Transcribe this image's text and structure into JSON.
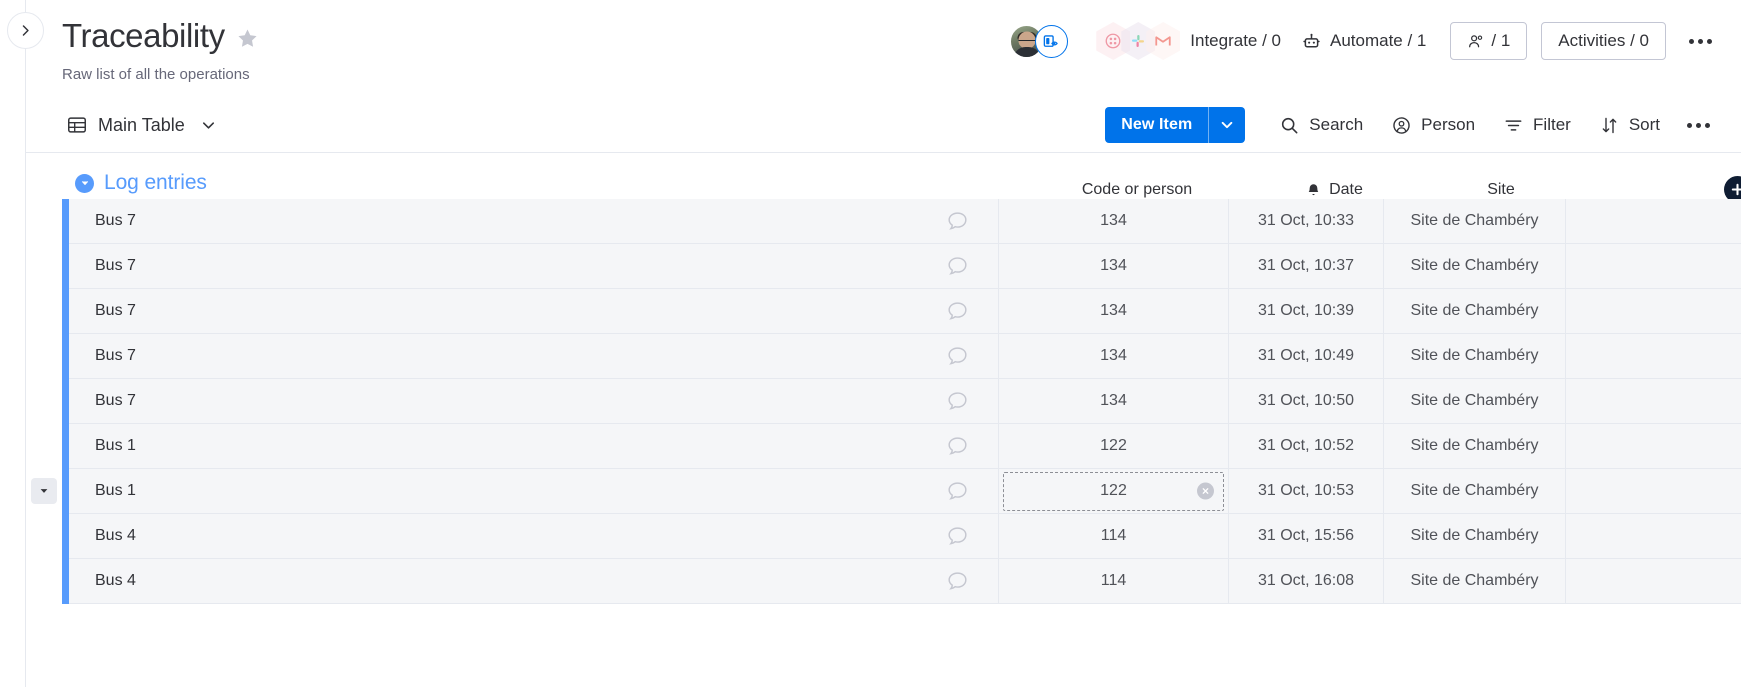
{
  "sidebar": {
    "expand_label": "Expand sidebar"
  },
  "header": {
    "title": "Traceability",
    "subtitle": "Raw list of all the operations",
    "star_label": "Add to favorites",
    "integrate": "Integrate / 0",
    "automate": "Automate / 1",
    "people": "/ 1",
    "activities": "Activities / 0",
    "more_label": "More options"
  },
  "toolbar": {
    "view_name": "Main Table",
    "new_item": "New Item",
    "search": "Search",
    "person": "Person",
    "filter": "Filter",
    "sort": "Sort",
    "more_label": "More options"
  },
  "table": {
    "group_name": "Log entries",
    "columns": [
      {
        "key": "name",
        "label": ""
      },
      {
        "key": "code",
        "label": "Code or person"
      },
      {
        "key": "date",
        "label": "Date"
      },
      {
        "key": "site",
        "label": "Site"
      }
    ],
    "add_column_label": "+",
    "rows": [
      {
        "name": "Bus 7",
        "code": "134",
        "date": "31 Oct, 10:33",
        "site": "Site de Chambéry"
      },
      {
        "name": "Bus 7",
        "code": "134",
        "date": "31 Oct, 10:37",
        "site": "Site de Chambéry"
      },
      {
        "name": "Bus 7",
        "code": "134",
        "date": "31 Oct, 10:39",
        "site": "Site de Chambéry"
      },
      {
        "name": "Bus 7",
        "code": "134",
        "date": "31 Oct, 10:49",
        "site": "Site de Chambéry"
      },
      {
        "name": "Bus 7",
        "code": "134",
        "date": "31 Oct, 10:50",
        "site": "Site de Chambéry"
      },
      {
        "name": "Bus 1",
        "code": "122",
        "date": "31 Oct, 10:52",
        "site": "Site de Chambéry"
      },
      {
        "name": "Bus 1",
        "code": "122",
        "date": "31 Oct, 10:53",
        "site": "Site de Chambéry"
      },
      {
        "name": "Bus 4",
        "code": "114",
        "date": "31 Oct, 15:56",
        "site": "Site de Chambéry"
      },
      {
        "name": "Bus 4",
        "code": "114",
        "date": "31 Oct, 16:08",
        "site": "Site de Chambéry"
      }
    ],
    "selected_row_index": 6,
    "selected_column": "code"
  },
  "colors": {
    "accent_blue": "#0073ea",
    "group_blue": "#579bfc",
    "row_bg": "#f5f6f8",
    "border": "#e6e9ef",
    "text": "#323338",
    "muted_text": "#676879"
  }
}
